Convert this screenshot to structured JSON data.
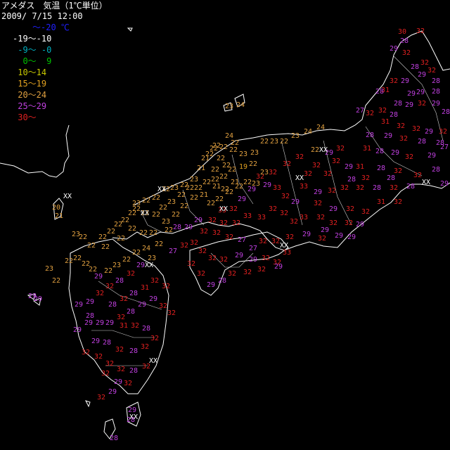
{
  "header": {
    "title": "アメダス　気温（1℃単位）",
    "datetime": "2009/ 7/15 12:00"
  },
  "legend": [
    {
      "label": "～-20 ℃",
      "color": "#2020ff"
    },
    {
      "label": "-19～-10",
      "color": "#ffffff"
    },
    {
      "label": " -9～ -0",
      "color": "#00b0c0"
    },
    {
      "label": "  0～  9",
      "color": "#00c000"
    },
    {
      "label": " 10～14",
      "color": "#c8c800"
    },
    {
      "label": " 15～19",
      "color": "#e0a020"
    },
    {
      "label": " 20～24",
      "color": "#e0a040"
    },
    {
      "label": " 25～29",
      "color": "#c040e0"
    },
    {
      "label": " 30～",
      "color": "#e02020"
    }
  ],
  "missing_mark": "XX",
  "stations": [
    {
      "t": "32",
      "c": 30
    },
    {
      "t": "28",
      "c": 25
    },
    {
      "t": "30",
      "c": 30
    },
    {
      "t": "29",
      "c": 25
    },
    {
      "t": "31",
      "c": 30
    },
    {
      "t": "24",
      "c": 20
    },
    {
      "t": "23",
      "c": 20
    },
    {
      "t": "22",
      "c": 20
    },
    {
      "t": "21",
      "c": 20
    },
    {
      "t": "19",
      "c": 15
    },
    {
      "t": "33",
      "c": 30
    },
    {
      "t": "34",
      "c": 30
    },
    {
      "t": "27",
      "c": 25
    },
    {
      "t": "20",
      "c": 20
    },
    {
      "t": "26",
      "c": 25
    },
    {
      "t": "35",
      "c": 30
    },
    {
      "t": "XX",
      "c": 0
    }
  ]
}
